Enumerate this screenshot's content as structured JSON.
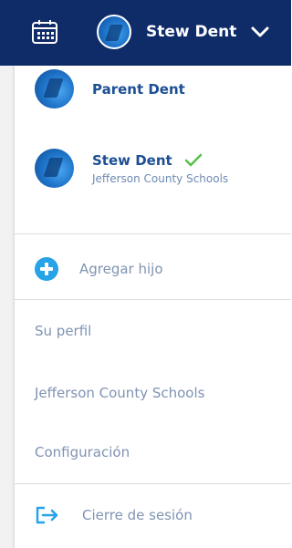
{
  "header": {
    "calendar_icon": "calendar-icon",
    "user_name": "Stew Dent",
    "chevron_icon": "chevron-down-icon"
  },
  "menu": {
    "profiles": [
      {
        "name": "Parent Dent",
        "subtitle": ""
      },
      {
        "name": "Stew Dent",
        "subtitle": "Jefferson County Schools",
        "selected_icon": "check-icon"
      }
    ],
    "add_child_label": "Agregar hijo",
    "profile_label": "Su perfil",
    "school_label": "Jefferson County Schools",
    "settings_label": "Configuración",
    "logout_label": "Cierre de sesión"
  },
  "colors": {
    "header_bg": "#0f2c69",
    "accent_blue": "#27a3e8",
    "name_blue": "#1c4f93",
    "muted_text": "#7f93b2",
    "check_green": "#55c04a"
  }
}
